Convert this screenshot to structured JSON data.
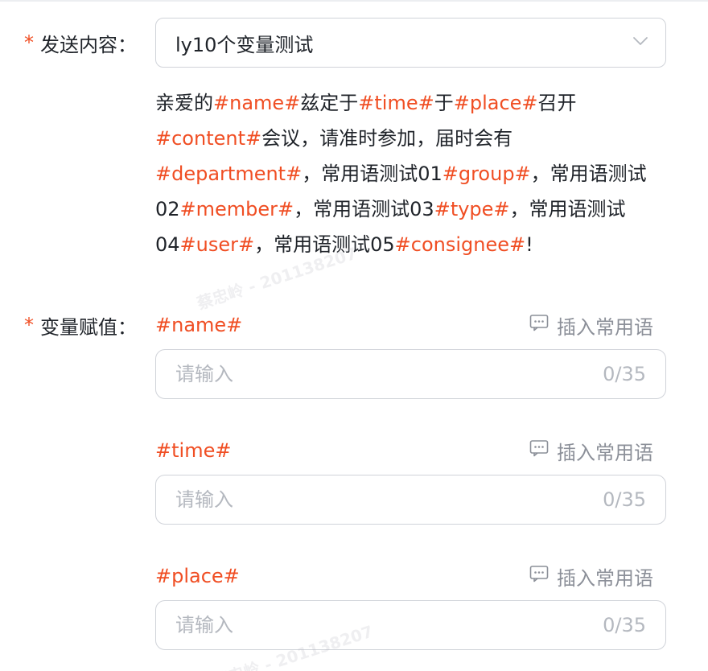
{
  "send_content": {
    "label": "发送内容：",
    "required_mark": "*",
    "selected_template": "ly10个变量测试",
    "template_segments": [
      {
        "text": "亲爱的",
        "var": false
      },
      {
        "text": "#name#",
        "var": true
      },
      {
        "text": "兹定于",
        "var": false
      },
      {
        "text": "#time#",
        "var": true
      },
      {
        "text": "于",
        "var": false
      },
      {
        "text": "#place#",
        "var": true
      },
      {
        "text": "召开",
        "var": false
      },
      {
        "text": "#content#",
        "var": true
      },
      {
        "text": "会议，请准时参加，届时会有",
        "var": false
      },
      {
        "text": "#department#",
        "var": true
      },
      {
        "text": "，常用语测试01",
        "var": false
      },
      {
        "text": "#group#",
        "var": true
      },
      {
        "text": "，常用语测试02",
        "var": false
      },
      {
        "text": "#member#",
        "var": true
      },
      {
        "text": "，常用语测试03",
        "var": false
      },
      {
        "text": "#type#",
        "var": true
      },
      {
        "text": "，常用语测试04",
        "var": false
      },
      {
        "text": "#user#",
        "var": true
      },
      {
        "text": "，常用语测试05",
        "var": false
      },
      {
        "text": "#consignee#",
        "var": true
      },
      {
        "text": "!",
        "var": false
      }
    ]
  },
  "assign": {
    "label": "变量赋值：",
    "required_mark": "*",
    "insert_label": "插入常用语",
    "variables": [
      {
        "name": "#name#",
        "placeholder": "请输入",
        "value": "",
        "counter": "0/35"
      },
      {
        "name": "#time#",
        "placeholder": "请输入",
        "value": "",
        "counter": "0/35"
      },
      {
        "name": "#place#",
        "placeholder": "请输入",
        "value": "",
        "counter": "0/35"
      }
    ]
  },
  "watermark": "蔡忠岭 - 201138207",
  "colors": {
    "accent": "#f04e23",
    "border": "#d0d3d9",
    "placeholder": "#b4b8bf",
    "muted": "#8c9099"
  }
}
